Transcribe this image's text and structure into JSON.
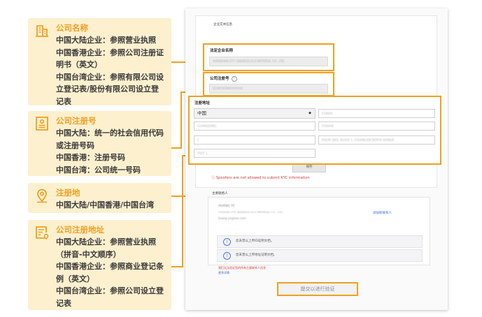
{
  "annotations": [
    {
      "icon": "building-icon",
      "title": "公司名称",
      "body": "中国大陆企业：参照营业执照\n中国香港企业：参照公司注册证明书（英文）\n中国台湾企业：参照有限公司设立登记表/股份有限公司设立登记表"
    },
    {
      "icon": "id-card-icon",
      "title": "公司注册号",
      "body": "中国大陆：统一的社会信用代码或注册号码\n中国香港：注册号码\n中国台湾：公司统一号码"
    },
    {
      "icon": "location-pin-icon",
      "title": "注册地",
      "body": "中国大陆/中国香港/中国台湾"
    },
    {
      "icon": "address-document-icon",
      "title": "公司注册地址",
      "body": "中国大陆企业：参照营业执照（拼音-中文顺序）\n中国香港企业：参照商业登记条例（英文）\n中国台湾企业：参照公司设立登记表"
    }
  ],
  "form": {
    "section_title": "企业实体信息",
    "company_name_label": "法定企业名称",
    "company_name_value": "SHENZHEN CITY ADDRESS ECO MATERIAL CO., LTD.",
    "reg_no_label": "公司注册号",
    "help_icon": "?",
    "reg_no_value": "91440300MA5XXXXX",
    "address_label": "注册地址",
    "country_value": "中国",
    "address_fields": [
      "518000",
      "GUANGDONG",
      "FOSHAN",
      "C",
      "ROOM 1803, BLOCK 1, CHUANGXIN NORTH AVENUE",
      "YOUT 1"
    ],
    "save_button": "保存",
    "warning_text": "Spoofers are not allowed to submit KYC information",
    "contact_section_title": "主要联络人",
    "contact_name": "HUANG YE",
    "contact_detail": "FOSHAN CITY ADDRESS ECO MATERIAL CO., LTD.",
    "contact_email": "huang.ye@xxx.com",
    "contact_link": "添加新联系人",
    "notice_1": "您未曾以上传ID证明文档。",
    "notice_2": "您未曾以上传地址证明文档。",
    "footer_notes": [
      "我们无法验证您的所有主要联系人信息",
      "更多详情"
    ],
    "submit_button": "提交以进行验证"
  }
}
